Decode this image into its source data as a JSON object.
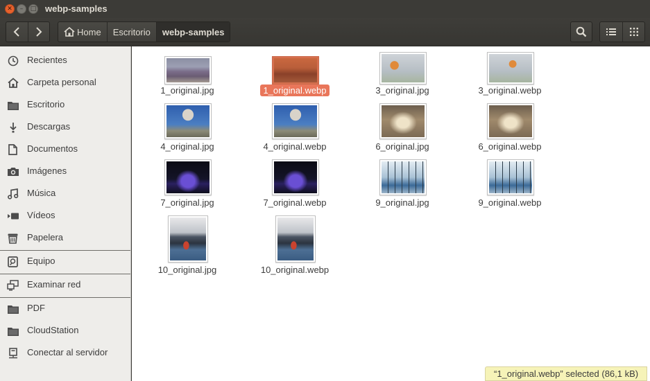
{
  "window": {
    "title": "webp-samples"
  },
  "header": {
    "breadcrumbs": [
      "Home",
      "Escritorio",
      "webp-samples"
    ]
  },
  "sidebar": {
    "items": [
      {
        "label": "Recientes",
        "icon": "clock-icon"
      },
      {
        "label": "Carpeta personal",
        "icon": "home-icon"
      },
      {
        "label": "Escritorio",
        "icon": "folder-icon"
      },
      {
        "label": "Descargas",
        "icon": "download-icon"
      },
      {
        "label": "Documentos",
        "icon": "document-icon"
      },
      {
        "label": "Imágenes",
        "icon": "camera-icon"
      },
      {
        "label": "Música",
        "icon": "music-icon"
      },
      {
        "label": "Vídeos",
        "icon": "video-icon"
      },
      {
        "label": "Papelera",
        "icon": "trash-icon"
      },
      {
        "label": "Equipo",
        "icon": "drive-icon"
      },
      {
        "label": "Examinar red",
        "icon": "network-icon"
      },
      {
        "label": "PDF",
        "icon": "folder-icon"
      },
      {
        "label": "CloudStation",
        "icon": "folder-icon"
      },
      {
        "label": "Conectar al servidor",
        "icon": "server-icon"
      }
    ]
  },
  "files": [
    {
      "name": "1_original.jpg"
    },
    {
      "name": "1_original.webp",
      "selected": true
    },
    {
      "name": "3_original.jpg"
    },
    {
      "name": "3_original.webp"
    },
    {
      "name": "4_original.jpg"
    },
    {
      "name": "4_original.webp"
    },
    {
      "name": "6_original.jpg"
    },
    {
      "name": "6_original.webp"
    },
    {
      "name": "7_original.jpg"
    },
    {
      "name": "7_original.webp"
    },
    {
      "name": "9_original.jpg"
    },
    {
      "name": "9_original.webp"
    },
    {
      "name": "10_original.jpg"
    },
    {
      "name": "10_original.webp"
    }
  ],
  "status": {
    "text": "“1_original.webp” selected  (86,1 kB)"
  },
  "colors": {
    "accent": "#e9765a",
    "titlebar": "#3c3b37",
    "sidebar": "#eeedea"
  }
}
